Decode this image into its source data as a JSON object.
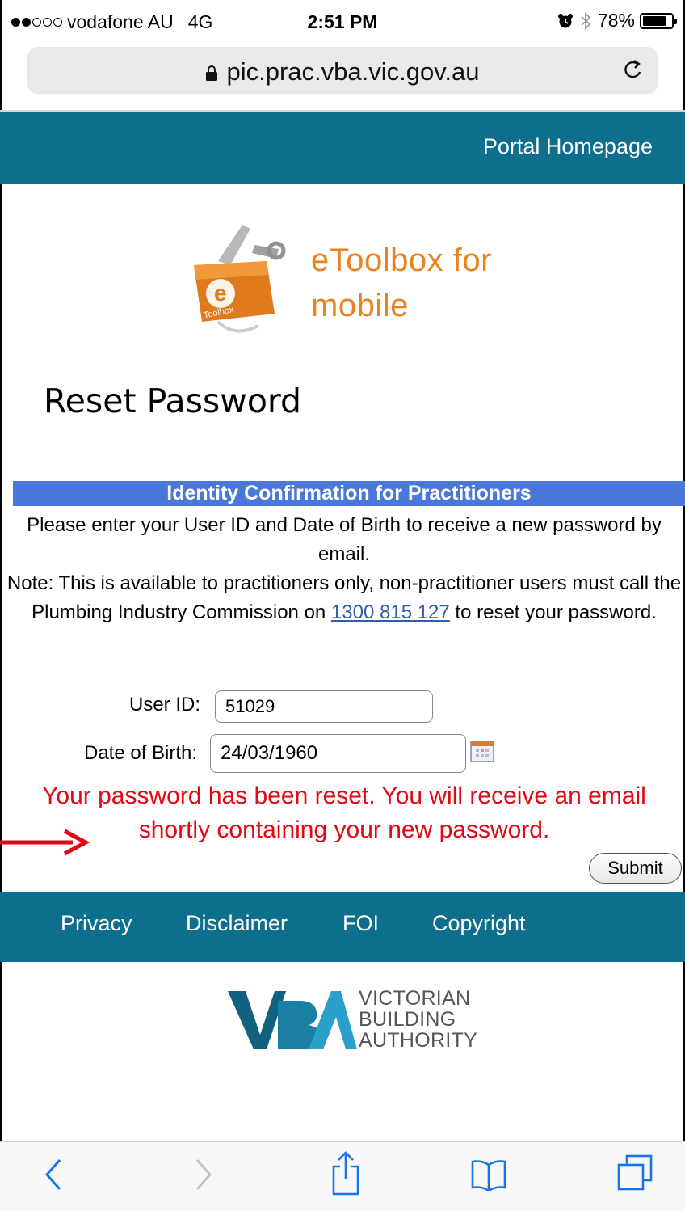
{
  "status_bar": {
    "carrier": "vodafone AU",
    "network": "4G",
    "time": "2:51 PM",
    "battery": "78%",
    "battery_level": 0.78,
    "signal_bars_filled": 2,
    "signal_bars_total": 5,
    "icons": [
      "alarm-icon",
      "bluetooth-icon",
      "battery-icon"
    ]
  },
  "browser": {
    "url": "pic.prac.vba.vic.gov.au",
    "icons": [
      "lock-icon",
      "reload-icon"
    ]
  },
  "header": {
    "portal_link": "Portal Homepage",
    "color": "#0e6f8d"
  },
  "logo": {
    "text_line1": "eToolbox for",
    "text_line2": "mobile",
    "badge_letter": "e",
    "badge_text": "Toolbox",
    "color": "#e8831f"
  },
  "page": {
    "title": "Reset Password"
  },
  "identity": {
    "heading": "Identity Confirmation for Practitioners",
    "instructions": "Please enter your User ID and Date of Birth to receive a new password by email.",
    "note_before": "Note: This is available to practitioners only, non-practitioner users must call the Plumbing Industry Commission on",
    "phone": "1300 815 127",
    "note_after": "to reset your password.",
    "bar_color": "#4a78d9"
  },
  "form": {
    "user_id_label": "User ID:",
    "user_id_value": "51029",
    "dob_label": "Date of Birth:",
    "dob_value": "24/03/1960",
    "success_message": "Your password has been reset. You will receive an email shortly containing your new password.",
    "message_color": "#e30613",
    "submit_label": "Submit"
  },
  "footer": {
    "links": [
      "Privacy",
      "Disclaimer",
      "FOI",
      "Copyright"
    ],
    "vba_line1": "VICTORIAN",
    "vba_line2": "BUILDING",
    "vba_line3": "AUTHORITY",
    "vba_letters": "VBA"
  },
  "toolbar": {
    "icons": [
      "back-icon",
      "forward-icon",
      "share-icon",
      "bookmarks-icon",
      "tabs-icon"
    ]
  }
}
